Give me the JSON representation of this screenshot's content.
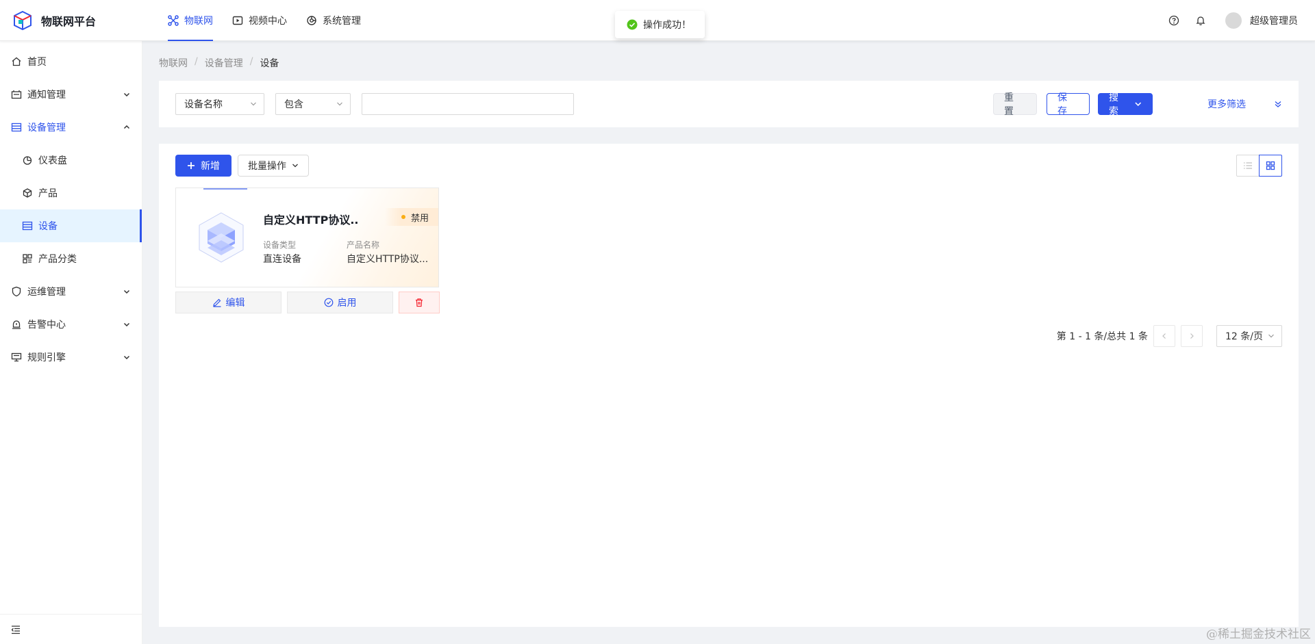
{
  "app": {
    "title": "物联网平台"
  },
  "top_nav": [
    {
      "label": "物联网",
      "active": true
    },
    {
      "label": "视频中心",
      "active": false
    },
    {
      "label": "系统管理",
      "active": false
    }
  ],
  "user": {
    "name": "超级管理员"
  },
  "toast": {
    "message": "操作成功！"
  },
  "sidebar": {
    "items": [
      {
        "label": "首页"
      },
      {
        "label": "通知管理"
      },
      {
        "label": "设备管理"
      },
      {
        "label": "仪表盘"
      },
      {
        "label": "产品"
      },
      {
        "label": "设备"
      },
      {
        "label": "产品分类"
      },
      {
        "label": "运维管理"
      },
      {
        "label": "告警中心"
      },
      {
        "label": "规则引擎"
      }
    ]
  },
  "breadcrumb": [
    "物联网",
    "设备管理",
    "设备"
  ],
  "filter": {
    "field_select": "设备名称",
    "operator_select": "包含",
    "value": "",
    "reset_label": "重置",
    "save_label": "保存",
    "search_label": "搜索",
    "more_filter_label": "更多筛选"
  },
  "toolbar": {
    "add_label": "新增",
    "batch_label": "批量操作"
  },
  "card": {
    "title": "自定义HTTP协议...",
    "status": "禁用",
    "status_color": "#faad14",
    "type_label": "设备类型",
    "type_value": "直连设备",
    "product_label": "产品名称",
    "product_value": "自定义HTTP协议..."
  },
  "card_actions": {
    "edit_label": "编辑",
    "enable_label": "启用"
  },
  "pagination": {
    "summary": "第 1 - 1 条/总共 1 条",
    "page_size": "12 条/页"
  },
  "watermark": "@稀土掘金技术社区",
  "colors": {
    "primary": "#2f54eb",
    "success": "#52c41a",
    "danger": "#f5222d",
    "warning": "#faad14"
  }
}
